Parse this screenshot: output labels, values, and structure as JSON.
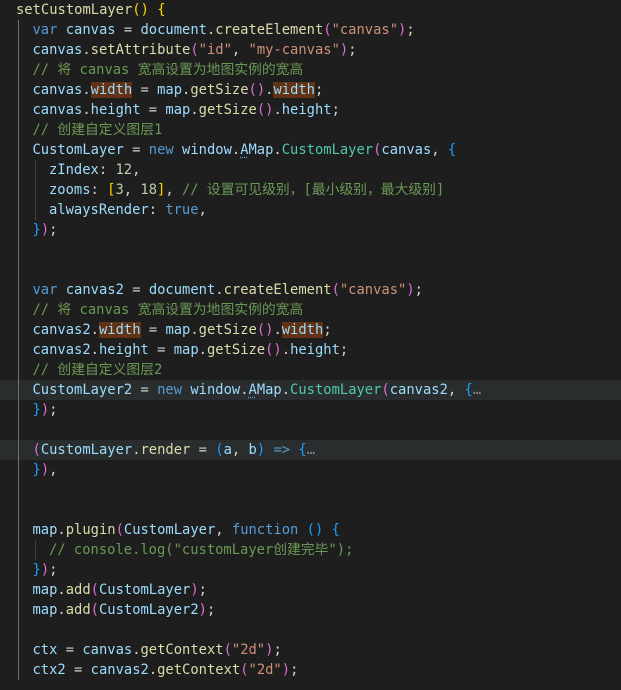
{
  "lines": [
    {
      "row": 0,
      "indent": 0,
      "tokens": [
        {
          "c": "t-fn",
          "t": "setCustomLayer"
        },
        {
          "c": "t-b1",
          "t": "()"
        },
        {
          "c": "t-pun",
          "t": " "
        },
        {
          "c": "t-b1",
          "t": "{"
        }
      ]
    },
    {
      "row": 1,
      "indent": 1,
      "tokens": [
        {
          "c": "t-kw",
          "t": "var"
        },
        {
          "c": "t-pun",
          "t": " "
        },
        {
          "c": "t-var",
          "t": "canvas"
        },
        {
          "c": "t-pun",
          "t": " = "
        },
        {
          "c": "t-var",
          "t": "document"
        },
        {
          "c": "t-pun",
          "t": "."
        },
        {
          "c": "t-fn",
          "t": "createElement"
        },
        {
          "c": "t-b2",
          "t": "("
        },
        {
          "c": "t-str",
          "t": "\"canvas\""
        },
        {
          "c": "t-b2",
          "t": ")"
        },
        {
          "c": "t-pun",
          "t": ";"
        }
      ]
    },
    {
      "row": 2,
      "indent": 1,
      "tokens": [
        {
          "c": "t-var",
          "t": "canvas"
        },
        {
          "c": "t-pun",
          "t": "."
        },
        {
          "c": "t-fn",
          "t": "setAttribute"
        },
        {
          "c": "t-b2",
          "t": "("
        },
        {
          "c": "t-str",
          "t": "\"id\""
        },
        {
          "c": "t-pun",
          "t": ", "
        },
        {
          "c": "t-str",
          "t": "\"my-canvas\""
        },
        {
          "c": "t-b2",
          "t": ")"
        },
        {
          "c": "t-pun",
          "t": ";"
        }
      ]
    },
    {
      "row": 3,
      "indent": 1,
      "tokens": [
        {
          "c": "t-com",
          "t": "// 将 canvas 宽高设置为地图实例的宽高"
        }
      ]
    },
    {
      "row": 4,
      "indent": 1,
      "tokens": [
        {
          "c": "t-var",
          "t": "canvas"
        },
        {
          "c": "t-pun",
          "t": "."
        },
        {
          "c": "t-hlw",
          "t": "width"
        },
        {
          "c": "t-pun",
          "t": " = "
        },
        {
          "c": "t-var",
          "t": "map"
        },
        {
          "c": "t-pun",
          "t": "."
        },
        {
          "c": "t-fn",
          "t": "getSize"
        },
        {
          "c": "t-b2",
          "t": "()"
        },
        {
          "c": "t-pun",
          "t": "."
        },
        {
          "c": "t-hlw",
          "t": "width"
        },
        {
          "c": "t-pun",
          "t": ";"
        }
      ]
    },
    {
      "row": 5,
      "indent": 1,
      "tokens": [
        {
          "c": "t-var",
          "t": "canvas"
        },
        {
          "c": "t-pun",
          "t": "."
        },
        {
          "c": "t-var",
          "t": "height"
        },
        {
          "c": "t-pun",
          "t": " = "
        },
        {
          "c": "t-var",
          "t": "map"
        },
        {
          "c": "t-pun",
          "t": "."
        },
        {
          "c": "t-fn",
          "t": "getSize"
        },
        {
          "c": "t-b2",
          "t": "()"
        },
        {
          "c": "t-pun",
          "t": "."
        },
        {
          "c": "t-var",
          "t": "height"
        },
        {
          "c": "t-pun",
          "t": ";"
        }
      ]
    },
    {
      "row": 6,
      "indent": 1,
      "tokens": [
        {
          "c": "t-com",
          "t": "// 创建自定义图层1"
        }
      ]
    },
    {
      "row": 7,
      "indent": 1,
      "tokens": [
        {
          "c": "t-var",
          "t": "CustomLayer"
        },
        {
          "c": "t-pun",
          "t": " = "
        },
        {
          "c": "t-kw",
          "t": "new"
        },
        {
          "c": "t-pun",
          "t": " "
        },
        {
          "c": "t-var",
          "t": "window"
        },
        {
          "c": "t-pun",
          "t": "."
        },
        {
          "c": "t-var t-warn",
          "t": "A"
        },
        {
          "c": "t-var",
          "t": "Map"
        },
        {
          "c": "t-pun",
          "t": "."
        },
        {
          "c": "t-cls",
          "t": "CustomLayer"
        },
        {
          "c": "t-b2",
          "t": "("
        },
        {
          "c": "t-var",
          "t": "canvas"
        },
        {
          "c": "t-pun",
          "t": ", "
        },
        {
          "c": "t-b3",
          "t": "{"
        }
      ]
    },
    {
      "row": 8,
      "indent": 2,
      "tokens": [
        {
          "c": "t-var",
          "t": "zIndex"
        },
        {
          "c": "t-pun",
          "t": ": "
        },
        {
          "c": "t-num",
          "t": "12"
        },
        {
          "c": "t-pun",
          "t": ","
        }
      ]
    },
    {
      "row": 9,
      "indent": 2,
      "tokens": [
        {
          "c": "t-var",
          "t": "zooms"
        },
        {
          "c": "t-pun",
          "t": ": "
        },
        {
          "c": "t-b1",
          "t": "["
        },
        {
          "c": "t-num",
          "t": "3"
        },
        {
          "c": "t-pun",
          "t": ", "
        },
        {
          "c": "t-num",
          "t": "18"
        },
        {
          "c": "t-b1",
          "t": "]"
        },
        {
          "c": "t-pun",
          "t": ", "
        },
        {
          "c": "t-com",
          "t": "// 设置可见级别，[最小级别，最大级别]"
        }
      ]
    },
    {
      "row": 10,
      "indent": 2,
      "tokens": [
        {
          "c": "t-var",
          "t": "alwaysRender"
        },
        {
          "c": "t-pun",
          "t": ": "
        },
        {
          "c": "t-kw",
          "t": "true"
        },
        {
          "c": "t-pun",
          "t": ","
        }
      ]
    },
    {
      "row": 11,
      "indent": 1,
      "tokens": [
        {
          "c": "t-b3",
          "t": "}"
        },
        {
          "c": "t-b2",
          "t": ")"
        },
        {
          "c": "t-pun",
          "t": ";"
        }
      ]
    },
    {
      "row": 14,
      "indent": 1,
      "tokens": [
        {
          "c": "t-kw",
          "t": "var"
        },
        {
          "c": "t-pun",
          "t": " "
        },
        {
          "c": "t-var",
          "t": "canvas2"
        },
        {
          "c": "t-pun",
          "t": " = "
        },
        {
          "c": "t-var",
          "t": "document"
        },
        {
          "c": "t-pun",
          "t": "."
        },
        {
          "c": "t-fn",
          "t": "createElement"
        },
        {
          "c": "t-b2",
          "t": "("
        },
        {
          "c": "t-str",
          "t": "\"canvas\""
        },
        {
          "c": "t-b2",
          "t": ")"
        },
        {
          "c": "t-pun",
          "t": ";"
        }
      ]
    },
    {
      "row": 15,
      "indent": 1,
      "tokens": [
        {
          "c": "t-com",
          "t": "// 将 canvas 宽高设置为地图实例的宽高"
        }
      ]
    },
    {
      "row": 16,
      "indent": 1,
      "tokens": [
        {
          "c": "t-var",
          "t": "canvas2"
        },
        {
          "c": "t-pun",
          "t": "."
        },
        {
          "c": "t-hlw",
          "t": "width"
        },
        {
          "c": "t-pun",
          "t": " = "
        },
        {
          "c": "t-var",
          "t": "map"
        },
        {
          "c": "t-pun",
          "t": "."
        },
        {
          "c": "t-fn",
          "t": "getSize"
        },
        {
          "c": "t-b2",
          "t": "()"
        },
        {
          "c": "t-pun",
          "t": "."
        },
        {
          "c": "t-hlw",
          "t": "width"
        },
        {
          "c": "t-pun",
          "t": ";"
        }
      ]
    },
    {
      "row": 17,
      "indent": 1,
      "tokens": [
        {
          "c": "t-var",
          "t": "canvas2"
        },
        {
          "c": "t-pun",
          "t": "."
        },
        {
          "c": "t-var",
          "t": "height"
        },
        {
          "c": "t-pun",
          "t": " = "
        },
        {
          "c": "t-var",
          "t": "map"
        },
        {
          "c": "t-pun",
          "t": "."
        },
        {
          "c": "t-fn",
          "t": "getSize"
        },
        {
          "c": "t-b2",
          "t": "()"
        },
        {
          "c": "t-pun",
          "t": "."
        },
        {
          "c": "t-var",
          "t": "height"
        },
        {
          "c": "t-pun",
          "t": ";"
        }
      ]
    },
    {
      "row": 18,
      "indent": 1,
      "tokens": [
        {
          "c": "t-com",
          "t": "// 创建自定义图层2"
        }
      ]
    },
    {
      "row": 19,
      "indent": 1,
      "hl": true,
      "tokens": [
        {
          "c": "t-var",
          "t": "CustomLayer2"
        },
        {
          "c": "t-pun",
          "t": " = "
        },
        {
          "c": "t-kw",
          "t": "new"
        },
        {
          "c": "t-pun",
          "t": " "
        },
        {
          "c": "t-var",
          "t": "window"
        },
        {
          "c": "t-pun",
          "t": "."
        },
        {
          "c": "t-var t-warn",
          "t": "A"
        },
        {
          "c": "t-var",
          "t": "Map"
        },
        {
          "c": "t-pun",
          "t": "."
        },
        {
          "c": "t-cls",
          "t": "CustomLayer"
        },
        {
          "c": "t-b2",
          "t": "("
        },
        {
          "c": "t-var",
          "t": "canvas2"
        },
        {
          "c": "t-pun",
          "t": ", "
        },
        {
          "c": "t-b3",
          "t": "{"
        },
        {
          "c": "t-fold",
          "t": "…"
        }
      ]
    },
    {
      "row": 20,
      "indent": 1,
      "tokens": [
        {
          "c": "t-b3",
          "t": "}"
        },
        {
          "c": "t-b2",
          "t": ")"
        },
        {
          "c": "t-pun",
          "t": ";"
        }
      ]
    },
    {
      "row": 22,
      "indent": 1,
      "hl": true,
      "tokens": [
        {
          "c": "t-b2",
          "t": "("
        },
        {
          "c": "t-var",
          "t": "CustomLayer"
        },
        {
          "c": "t-pun",
          "t": "."
        },
        {
          "c": "t-fn",
          "t": "render"
        },
        {
          "c": "t-pun",
          "t": " = "
        },
        {
          "c": "t-b3",
          "t": "("
        },
        {
          "c": "t-var",
          "t": "a"
        },
        {
          "c": "t-pun",
          "t": ", "
        },
        {
          "c": "t-var",
          "t": "b"
        },
        {
          "c": "t-b3",
          "t": ")"
        },
        {
          "c": "t-pun",
          "t": " "
        },
        {
          "c": "t-kw",
          "t": "=>"
        },
        {
          "c": "t-pun",
          "t": " "
        },
        {
          "c": "t-b3",
          "t": "{"
        },
        {
          "c": "t-fold",
          "t": "…"
        }
      ]
    },
    {
      "row": 23,
      "indent": 1,
      "tokens": [
        {
          "c": "t-b3",
          "t": "}"
        },
        {
          "c": "t-b2",
          "t": ")"
        },
        {
          "c": "t-pun",
          "t": ","
        }
      ]
    },
    {
      "row": 26,
      "indent": 1,
      "tokens": [
        {
          "c": "t-var",
          "t": "map"
        },
        {
          "c": "t-pun",
          "t": "."
        },
        {
          "c": "t-fn",
          "t": "plugin"
        },
        {
          "c": "t-b2",
          "t": "("
        },
        {
          "c": "t-var",
          "t": "CustomLayer"
        },
        {
          "c": "t-pun",
          "t": ", "
        },
        {
          "c": "t-kw",
          "t": "function"
        },
        {
          "c": "t-pun",
          "t": " "
        },
        {
          "c": "t-b3",
          "t": "()"
        },
        {
          "c": "t-pun",
          "t": " "
        },
        {
          "c": "t-b3",
          "t": "{"
        }
      ]
    },
    {
      "row": 27,
      "indent": 2,
      "tokens": [
        {
          "c": "t-com",
          "t": "// console.log(\"customLayer创建完毕\");"
        }
      ]
    },
    {
      "row": 28,
      "indent": 1,
      "tokens": [
        {
          "c": "t-b3",
          "t": "}"
        },
        {
          "c": "t-b2",
          "t": ")"
        },
        {
          "c": "t-pun",
          "t": ";"
        }
      ]
    },
    {
      "row": 29,
      "indent": 1,
      "tokens": [
        {
          "c": "t-var",
          "t": "map"
        },
        {
          "c": "t-pun",
          "t": "."
        },
        {
          "c": "t-fn",
          "t": "add"
        },
        {
          "c": "t-b2",
          "t": "("
        },
        {
          "c": "t-var",
          "t": "CustomLayer"
        },
        {
          "c": "t-b2",
          "t": ")"
        },
        {
          "c": "t-pun",
          "t": ";"
        }
      ]
    },
    {
      "row": 30,
      "indent": 1,
      "tokens": [
        {
          "c": "t-var",
          "t": "map"
        },
        {
          "c": "t-pun",
          "t": "."
        },
        {
          "c": "t-fn",
          "t": "add"
        },
        {
          "c": "t-b2",
          "t": "("
        },
        {
          "c": "t-var",
          "t": "CustomLayer2"
        },
        {
          "c": "t-b2",
          "t": ")"
        },
        {
          "c": "t-pun",
          "t": ";"
        }
      ]
    },
    {
      "row": 32,
      "indent": 1,
      "tokens": [
        {
          "c": "t-var",
          "t": "ctx"
        },
        {
          "c": "t-pun",
          "t": " = "
        },
        {
          "c": "t-var",
          "t": "canvas"
        },
        {
          "c": "t-pun",
          "t": "."
        },
        {
          "c": "t-fn",
          "t": "getContext"
        },
        {
          "c": "t-b2",
          "t": "("
        },
        {
          "c": "t-str",
          "t": "\"2d\""
        },
        {
          "c": "t-b2",
          "t": ")"
        },
        {
          "c": "t-pun",
          "t": ";"
        }
      ]
    },
    {
      "row": 33,
      "indent": 1,
      "tokens": [
        {
          "c": "t-var",
          "t": "ctx2"
        },
        {
          "c": "t-pun",
          "t": " = "
        },
        {
          "c": "t-var",
          "t": "canvas2"
        },
        {
          "c": "t-pun",
          "t": "."
        },
        {
          "c": "t-fn",
          "t": "getContext"
        },
        {
          "c": "t-b2",
          "t": "("
        },
        {
          "c": "t-str",
          "t": "\"2d\""
        },
        {
          "c": "t-b2",
          "t": ")"
        },
        {
          "c": "t-pun",
          "t": ";"
        }
      ]
    }
  ]
}
